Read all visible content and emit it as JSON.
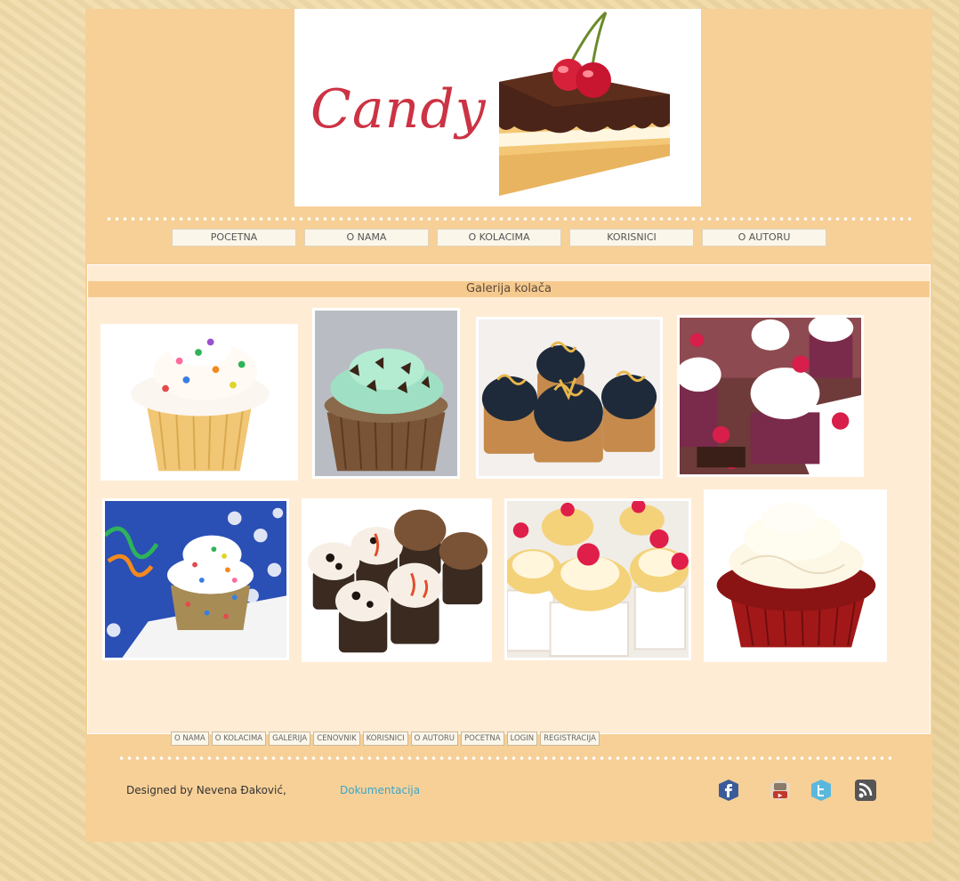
{
  "logo": {
    "text": "Candy"
  },
  "nav": {
    "items": [
      "POCETNA",
      "O NAMA",
      "O KOLACIMA",
      "KORISNICI",
      "O AUTORU"
    ]
  },
  "gallery": {
    "title": "Galerija kolača",
    "images": [
      "sprinkles-cupcake",
      "mint-chocolate-cupcake",
      "dark-fondant-cupcakes",
      "raspberry-cupcakes",
      "funfetti-cupcake",
      "cookies-and-cream-cupcakes",
      "lemon-raspberry-cupcakes",
      "red-velvet-cupcake"
    ]
  },
  "footer": {
    "nav": [
      "O NAMA",
      "O KOLACIMA",
      "GALERIJA",
      "CENOVNIK",
      "KORISNICI",
      "O AUTORU",
      "POCETNA",
      "LOGIN",
      "REGISTRACIJA"
    ],
    "credit": "Designed by Nevena Đaković,",
    "doc_link": "Dokumentacija",
    "social": [
      "facebook-icon",
      "youtube-icon",
      "twitter-icon",
      "rss-icon"
    ]
  },
  "colors": {
    "page_bg": "#f7d097",
    "content_bg": "#ffecd4",
    "title_bar": "#f6ca8f",
    "logo_text": "#cc3344",
    "link": "#3aa6c9"
  }
}
